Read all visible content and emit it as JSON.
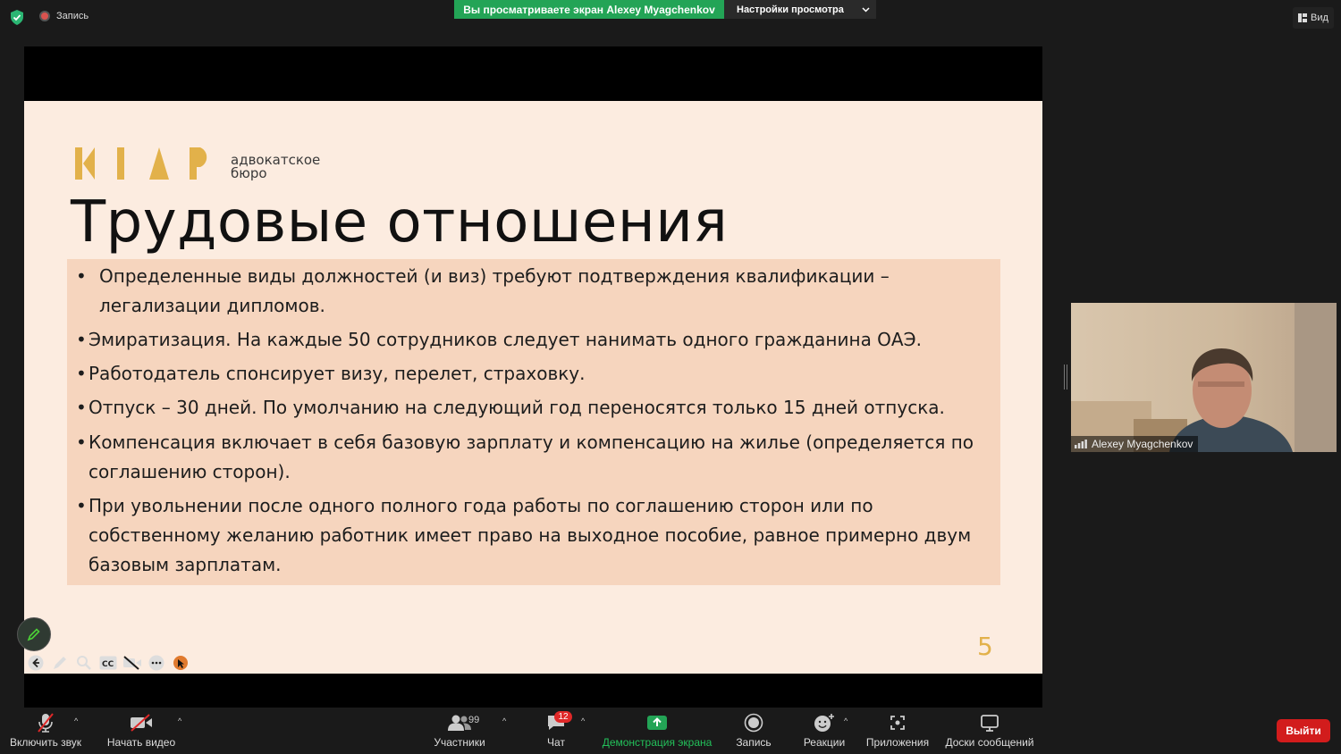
{
  "top": {
    "recording_label": "Запись",
    "viewing_banner": "Вы просматриваете экран Alexey Myagchenkov",
    "view_settings": "Настройки просмотра",
    "view_button": "Вид"
  },
  "slide": {
    "logo_letters": "К І А Р",
    "logo_sub_line1": "адвокатское",
    "logo_sub_line2": "бюро",
    "title": "Трудовые отношения",
    "bullets": [
      {
        "line1": "Определенные виды должностей (и виз) требуют подтверждения квалификации –",
        "line2": "легализации дипломов."
      },
      {
        "line1": "Эмиратизация. На каждые 50 сотрудников следует нанимать одного гражданина ОАЭ."
      },
      {
        "line1": "Работодатель спонсирует визу, перелет, страховку."
      },
      {
        "line1": "Отпуск – 30 дней. По умолчанию на следующий год переносятся только 15 дней отпуска."
      },
      {
        "line1": "Компенсация включает в себя базовую зарплату и компенсацию на жилье (определяется по",
        "line2": "соглашению сторон)."
      },
      {
        "line1": "При увольнении после одного полного года работы по соглашению сторон или по",
        "line2": "собственному желанию работник имеет право на выходное пособие, равное примерно двум",
        "line3": "базовым зарплатам."
      }
    ],
    "bullet_glyph": "•",
    "page_number": "5",
    "accent_color": "#e2b14a"
  },
  "participant": {
    "name": "Alexey Myagchenkov"
  },
  "toolbar": {
    "unmute": "Включить звук",
    "start_video": "Начать видео",
    "participants": "Участники",
    "participants_count": "99",
    "chat": "Чат",
    "chat_badge": "12",
    "share_screen": "Демонстрация экрана",
    "record": "Запись",
    "reactions": "Реакции",
    "apps": "Приложения",
    "whiteboards": "Доски сообщений",
    "exit": "Выйти"
  }
}
